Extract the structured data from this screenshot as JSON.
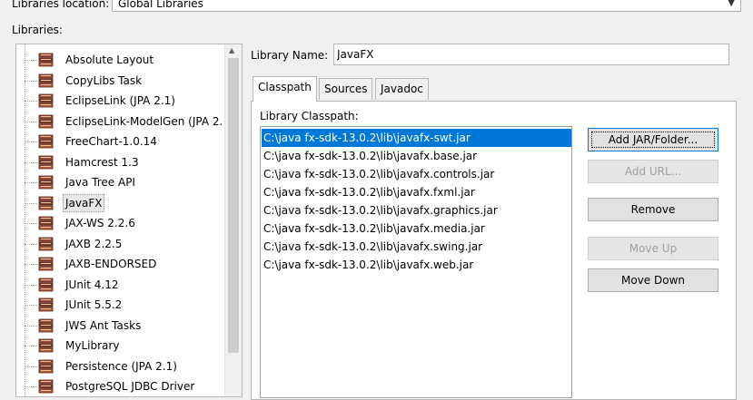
{
  "location": {
    "label": "Libraries location:",
    "value": "Global Libraries"
  },
  "libraries_label": "Libraries:",
  "libraries": [
    {
      "label": "Absolute Layout"
    },
    {
      "label": "CopyLibs Task"
    },
    {
      "label": "EclipseLink (JPA 2.1)"
    },
    {
      "label": "EclipseLink-ModelGen (JPA 2."
    },
    {
      "label": "FreeChart-1.0.14"
    },
    {
      "label": "Hamcrest 1.3"
    },
    {
      "label": "Java Tree API"
    },
    {
      "label": "JavaFX"
    },
    {
      "label": "JAX-WS 2.2.6"
    },
    {
      "label": "JAXB 2.2.5"
    },
    {
      "label": "JAXB-ENDORSED"
    },
    {
      "label": "JUnit 4.12"
    },
    {
      "label": "JUnit 5.5.2"
    },
    {
      "label": "JWS Ant Tasks"
    },
    {
      "label": "MyLibrary"
    },
    {
      "label": "Persistence (JPA 2.1)"
    },
    {
      "label": "PostgreSQL JDBC Driver"
    }
  ],
  "selected_library": "JavaFX",
  "library_name": {
    "label": "Library Name:",
    "value": "JavaFX"
  },
  "tabs": [
    {
      "label": "Classpath",
      "active": true
    },
    {
      "label": "Sources",
      "active": false
    },
    {
      "label": "Javadoc",
      "active": false
    }
  ],
  "classpath": {
    "label": "Library Classpath:",
    "entries": [
      "C:\\java fx-sdk-13.0.2\\lib\\javafx-swt.jar",
      "C:\\java fx-sdk-13.0.2\\lib\\javafx.base.jar",
      "C:\\java fx-sdk-13.0.2\\lib\\javafx.controls.jar",
      "C:\\java fx-sdk-13.0.2\\lib\\javafx.fxml.jar",
      "C:\\java fx-sdk-13.0.2\\lib\\javafx.graphics.jar",
      "C:\\java fx-sdk-13.0.2\\lib\\javafx.media.jar",
      "C:\\java fx-sdk-13.0.2\\lib\\javafx.swing.jar",
      "C:\\java fx-sdk-13.0.2\\lib\\javafx.web.jar"
    ]
  },
  "buttons": {
    "add_jar": "Add JAR/Folder...",
    "add_url": "Add URL...",
    "remove": "Remove",
    "move_up": "Move Up",
    "move_down": "Move Down"
  },
  "colors": {
    "selection": "#0078d7",
    "icon_book": "#8a3a2a"
  }
}
